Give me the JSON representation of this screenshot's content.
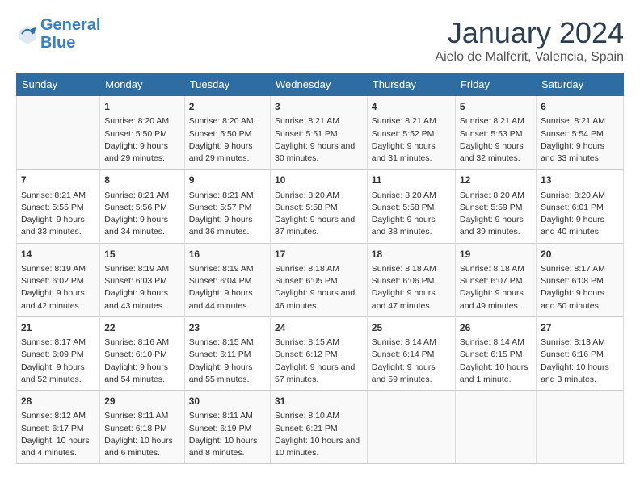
{
  "logo": {
    "line1": "General",
    "line2": "Blue"
  },
  "title": "January 2024",
  "subtitle": "Aielo de Malferit, Valencia, Spain",
  "weekdays": [
    "Sunday",
    "Monday",
    "Tuesday",
    "Wednesday",
    "Thursday",
    "Friday",
    "Saturday"
  ],
  "rows": [
    [
      {
        "day": "",
        "sunrise": "",
        "sunset": "",
        "daylight": ""
      },
      {
        "day": "1",
        "sunrise": "Sunrise: 8:20 AM",
        "sunset": "Sunset: 5:50 PM",
        "daylight": "Daylight: 9 hours and 29 minutes."
      },
      {
        "day": "2",
        "sunrise": "Sunrise: 8:20 AM",
        "sunset": "Sunset: 5:50 PM",
        "daylight": "Daylight: 9 hours and 29 minutes."
      },
      {
        "day": "3",
        "sunrise": "Sunrise: 8:21 AM",
        "sunset": "Sunset: 5:51 PM",
        "daylight": "Daylight: 9 hours and 30 minutes."
      },
      {
        "day": "4",
        "sunrise": "Sunrise: 8:21 AM",
        "sunset": "Sunset: 5:52 PM",
        "daylight": "Daylight: 9 hours and 31 minutes."
      },
      {
        "day": "5",
        "sunrise": "Sunrise: 8:21 AM",
        "sunset": "Sunset: 5:53 PM",
        "daylight": "Daylight: 9 hours and 32 minutes."
      },
      {
        "day": "6",
        "sunrise": "Sunrise: 8:21 AM",
        "sunset": "Sunset: 5:54 PM",
        "daylight": "Daylight: 9 hours and 33 minutes."
      }
    ],
    [
      {
        "day": "7",
        "sunrise": "Sunrise: 8:21 AM",
        "sunset": "Sunset: 5:55 PM",
        "daylight": "Daylight: 9 hours and 33 minutes."
      },
      {
        "day": "8",
        "sunrise": "Sunrise: 8:21 AM",
        "sunset": "Sunset: 5:56 PM",
        "daylight": "Daylight: 9 hours and 34 minutes."
      },
      {
        "day": "9",
        "sunrise": "Sunrise: 8:21 AM",
        "sunset": "Sunset: 5:57 PM",
        "daylight": "Daylight: 9 hours and 36 minutes."
      },
      {
        "day": "10",
        "sunrise": "Sunrise: 8:20 AM",
        "sunset": "Sunset: 5:58 PM",
        "daylight": "Daylight: 9 hours and 37 minutes."
      },
      {
        "day": "11",
        "sunrise": "Sunrise: 8:20 AM",
        "sunset": "Sunset: 5:58 PM",
        "daylight": "Daylight: 9 hours and 38 minutes."
      },
      {
        "day": "12",
        "sunrise": "Sunrise: 8:20 AM",
        "sunset": "Sunset: 5:59 PM",
        "daylight": "Daylight: 9 hours and 39 minutes."
      },
      {
        "day": "13",
        "sunrise": "Sunrise: 8:20 AM",
        "sunset": "Sunset: 6:01 PM",
        "daylight": "Daylight: 9 hours and 40 minutes."
      }
    ],
    [
      {
        "day": "14",
        "sunrise": "Sunrise: 8:19 AM",
        "sunset": "Sunset: 6:02 PM",
        "daylight": "Daylight: 9 hours and 42 minutes."
      },
      {
        "day": "15",
        "sunrise": "Sunrise: 8:19 AM",
        "sunset": "Sunset: 6:03 PM",
        "daylight": "Daylight: 9 hours and 43 minutes."
      },
      {
        "day": "16",
        "sunrise": "Sunrise: 8:19 AM",
        "sunset": "Sunset: 6:04 PM",
        "daylight": "Daylight: 9 hours and 44 minutes."
      },
      {
        "day": "17",
        "sunrise": "Sunrise: 8:18 AM",
        "sunset": "Sunset: 6:05 PM",
        "daylight": "Daylight: 9 hours and 46 minutes."
      },
      {
        "day": "18",
        "sunrise": "Sunrise: 8:18 AM",
        "sunset": "Sunset: 6:06 PM",
        "daylight": "Daylight: 9 hours and 47 minutes."
      },
      {
        "day": "19",
        "sunrise": "Sunrise: 8:18 AM",
        "sunset": "Sunset: 6:07 PM",
        "daylight": "Daylight: 9 hours and 49 minutes."
      },
      {
        "day": "20",
        "sunrise": "Sunrise: 8:17 AM",
        "sunset": "Sunset: 6:08 PM",
        "daylight": "Daylight: 9 hours and 50 minutes."
      }
    ],
    [
      {
        "day": "21",
        "sunrise": "Sunrise: 8:17 AM",
        "sunset": "Sunset: 6:09 PM",
        "daylight": "Daylight: 9 hours and 52 minutes."
      },
      {
        "day": "22",
        "sunrise": "Sunrise: 8:16 AM",
        "sunset": "Sunset: 6:10 PM",
        "daylight": "Daylight: 9 hours and 54 minutes."
      },
      {
        "day": "23",
        "sunrise": "Sunrise: 8:15 AM",
        "sunset": "Sunset: 6:11 PM",
        "daylight": "Daylight: 9 hours and 55 minutes."
      },
      {
        "day": "24",
        "sunrise": "Sunrise: 8:15 AM",
        "sunset": "Sunset: 6:12 PM",
        "daylight": "Daylight: 9 hours and 57 minutes."
      },
      {
        "day": "25",
        "sunrise": "Sunrise: 8:14 AM",
        "sunset": "Sunset: 6:14 PM",
        "daylight": "Daylight: 9 hours and 59 minutes."
      },
      {
        "day": "26",
        "sunrise": "Sunrise: 8:14 AM",
        "sunset": "Sunset: 6:15 PM",
        "daylight": "Daylight: 10 hours and 1 minute."
      },
      {
        "day": "27",
        "sunrise": "Sunrise: 8:13 AM",
        "sunset": "Sunset: 6:16 PM",
        "daylight": "Daylight: 10 hours and 3 minutes."
      }
    ],
    [
      {
        "day": "28",
        "sunrise": "Sunrise: 8:12 AM",
        "sunset": "Sunset: 6:17 PM",
        "daylight": "Daylight: 10 hours and 4 minutes."
      },
      {
        "day": "29",
        "sunrise": "Sunrise: 8:11 AM",
        "sunset": "Sunset: 6:18 PM",
        "daylight": "Daylight: 10 hours and 6 minutes."
      },
      {
        "day": "30",
        "sunrise": "Sunrise: 8:11 AM",
        "sunset": "Sunset: 6:19 PM",
        "daylight": "Daylight: 10 hours and 8 minutes."
      },
      {
        "day": "31",
        "sunrise": "Sunrise: 8:10 AM",
        "sunset": "Sunset: 6:21 PM",
        "daylight": "Daylight: 10 hours and 10 minutes."
      },
      {
        "day": "",
        "sunrise": "",
        "sunset": "",
        "daylight": ""
      },
      {
        "day": "",
        "sunrise": "",
        "sunset": "",
        "daylight": ""
      },
      {
        "day": "",
        "sunrise": "",
        "sunset": "",
        "daylight": ""
      }
    ]
  ]
}
